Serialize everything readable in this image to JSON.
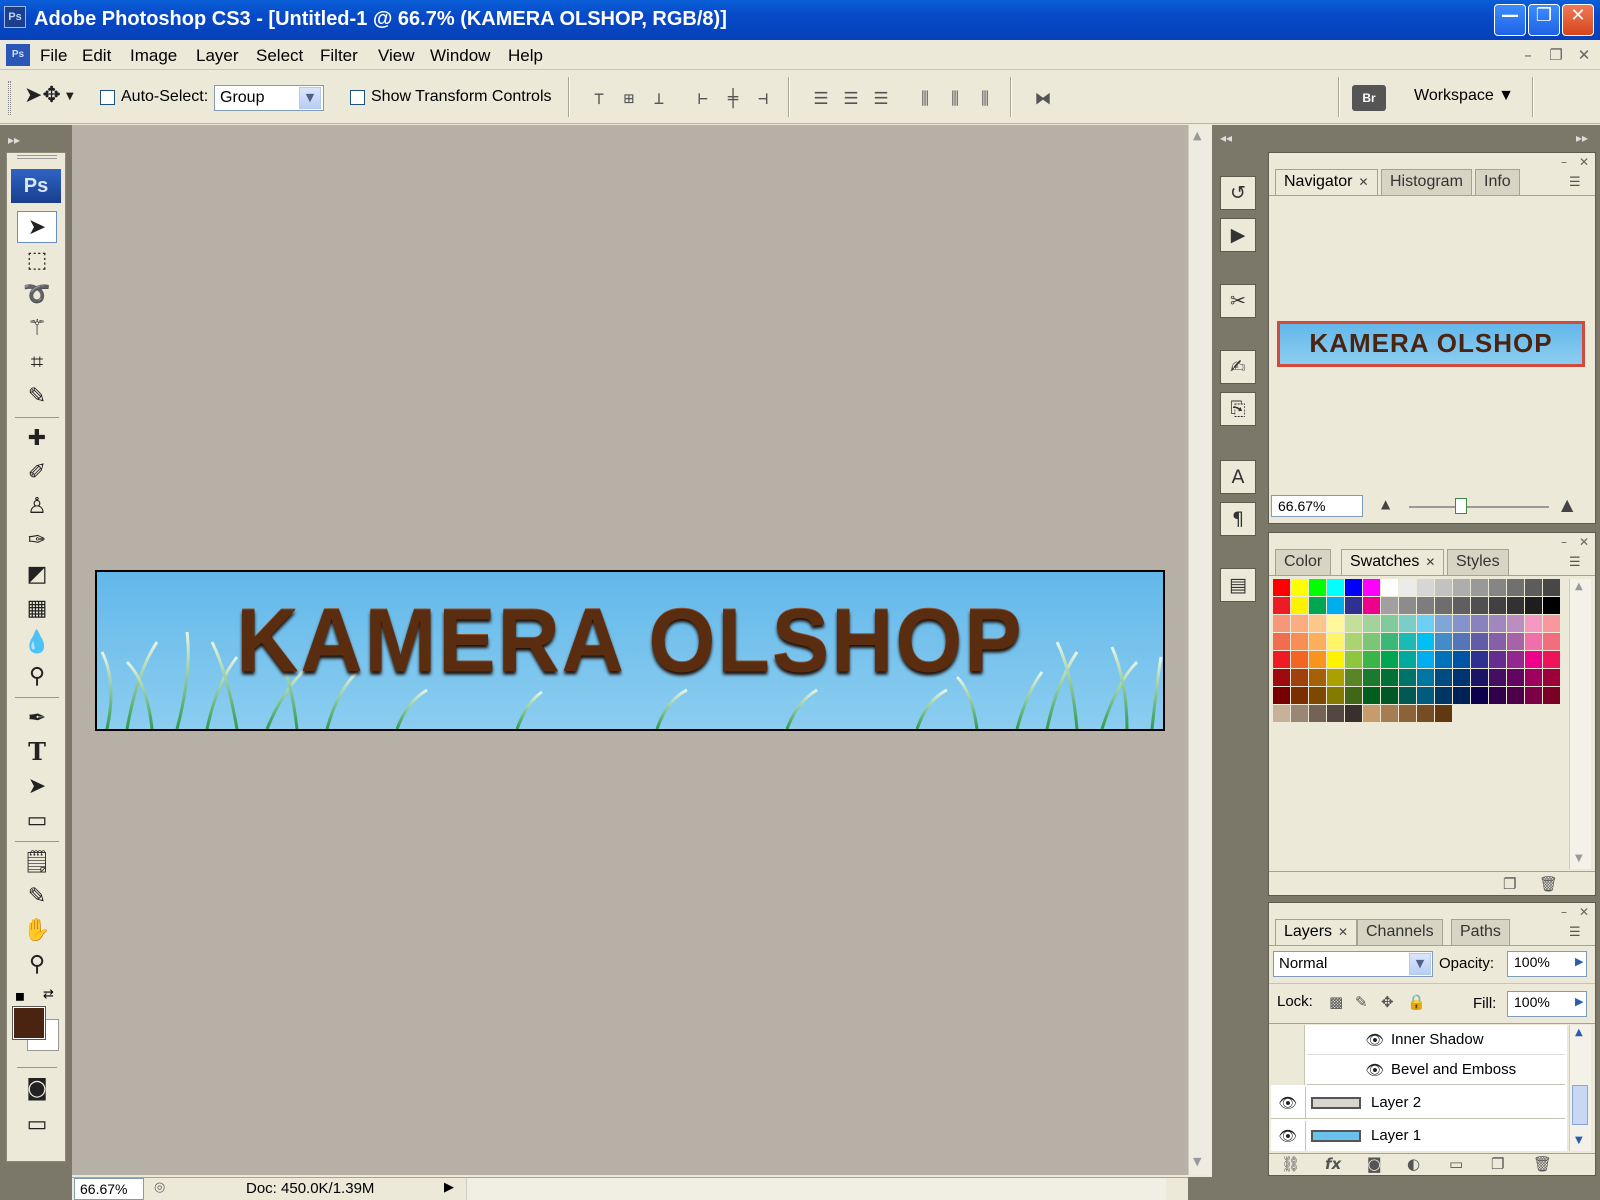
{
  "window": {
    "app_icon": "Ps",
    "title": "Adobe Photoshop CS3 - [Untitled-1 @ 66.7% (KAMERA OLSHOP, RGB/8)]",
    "minimize_glyph": "—",
    "maximize_glyph": "❐",
    "close_glyph": "✕"
  },
  "menu": {
    "doc_icon": "Ps",
    "items": [
      "File",
      "Edit",
      "Image",
      "Layer",
      "Select",
      "Filter",
      "View",
      "Window",
      "Help"
    ],
    "mdi_min": "–",
    "mdi_restore": "❐",
    "mdi_close": "✕"
  },
  "options": {
    "auto_select_label": "Auto-Select:",
    "auto_select_value": "Group",
    "show_transform_label": "Show Transform Controls",
    "workspace_label": "Workspace ▼",
    "bridge_icon": "Br"
  },
  "toolbox": {
    "logo": "Ps",
    "foreground_color": "#4a2410",
    "background_color": "#ffffff"
  },
  "canvas": {
    "banner_text": "KAMERA OLSHOP",
    "sky_color": "#6cc0ec",
    "text_color": "#5a2c10"
  },
  "status": {
    "zoom": "66.67%",
    "doc_info": "Doc: 450.0K/1.39M"
  },
  "navigator": {
    "tabs": [
      "Navigator",
      "Histogram",
      "Info"
    ],
    "thumbnail_text": "KAMERA OLSHOP",
    "zoom_value": "66.67%"
  },
  "swatches": {
    "tabs": [
      "Color",
      "Swatches",
      "Styles"
    ],
    "row1": [
      "#ff0000",
      "#ffff00",
      "#00ff00",
      "#00ffff",
      "#0000ff",
      "#ff00ff",
      "#ffffff",
      "#ebebeb",
      "#d6d6d6",
      "#c2c2c2",
      "#adadad",
      "#999999",
      "#858585",
      "#707070",
      "#5c5c5c",
      "#474747"
    ],
    "row2": [
      "#ed1c24",
      "#fff200",
      "#00a651",
      "#00aeef",
      "#2e3192",
      "#ec008c",
      "#a0a0a0",
      "#8c8c8c",
      "#7d7d7d",
      "#6e6e6e",
      "#5f5f5f",
      "#505050",
      "#414141",
      "#323232",
      "#1e1e1e",
      "#000000"
    ],
    "rows": [
      [
        "#f7977a",
        "#f9ad81",
        "#fdc68a",
        "#fff79a",
        "#c4df9b",
        "#a3d39c",
        "#82ca9d",
        "#7bcdc8",
        "#6ecff6",
        "#7ea7d8",
        "#8493ca",
        "#8882be",
        "#a187be",
        "#bc8dbf",
        "#f49ac2",
        "#f6989d"
      ],
      [
        "#f26c4f",
        "#f68e55",
        "#fbaf5c",
        "#fff467",
        "#acd372",
        "#7cc576",
        "#3bb878",
        "#1abbb4",
        "#00bff3",
        "#438cca",
        "#5574b9",
        "#605ca8",
        "#855fa8",
        "#a763a8",
        "#f06eaa",
        "#f26d7d"
      ],
      [
        "#ed1c24",
        "#f26522",
        "#f7941d",
        "#fff200",
        "#8dc73f",
        "#39b54a",
        "#00a651",
        "#00a99d",
        "#00aeef",
        "#0072bc",
        "#0054a6",
        "#2e3192",
        "#662d91",
        "#92278f",
        "#ec008c",
        "#ed145b"
      ],
      [
        "#9e0b0f",
        "#a0410d",
        "#a36209",
        "#aba000",
        "#598527",
        "#1a7b30",
        "#007236",
        "#00746b",
        "#0076a3",
        "#004b80",
        "#003471",
        "#1b1464",
        "#440e62",
        "#630460",
        "#9e005d",
        "#9e0039"
      ],
      [
        "#790000",
        "#7b2e00",
        "#7d4900",
        "#827b00",
        "#406618",
        "#005e20",
        "#005826",
        "#005952",
        "#005b7f",
        "#003663",
        "#002157",
        "#0d004c",
        "#32004b",
        "#4b0049",
        "#7b0046",
        "#7a0026"
      ]
    ],
    "browns": [
      "#c7b299",
      "#998675",
      "#736357",
      "#534741",
      "#37302d",
      "#c69c6d",
      "#a67c52",
      "#8c6239",
      "#754c24",
      "#603913"
    ]
  },
  "layers": {
    "tabs": [
      "Layers",
      "Channels",
      "Paths"
    ],
    "blend_mode": "Normal",
    "opacity_label": "Opacity:",
    "opacity_value": "100%",
    "lock_label": "Lock:",
    "fill_label": "Fill:",
    "fill_value": "100%",
    "effects": [
      "Inner Shadow",
      "Bevel and Emboss"
    ],
    "items": [
      {
        "name": "Layer 2",
        "swatch": "#d8d6cc"
      },
      {
        "name": "Layer 1",
        "swatch": "#6cc0ec"
      }
    ]
  }
}
